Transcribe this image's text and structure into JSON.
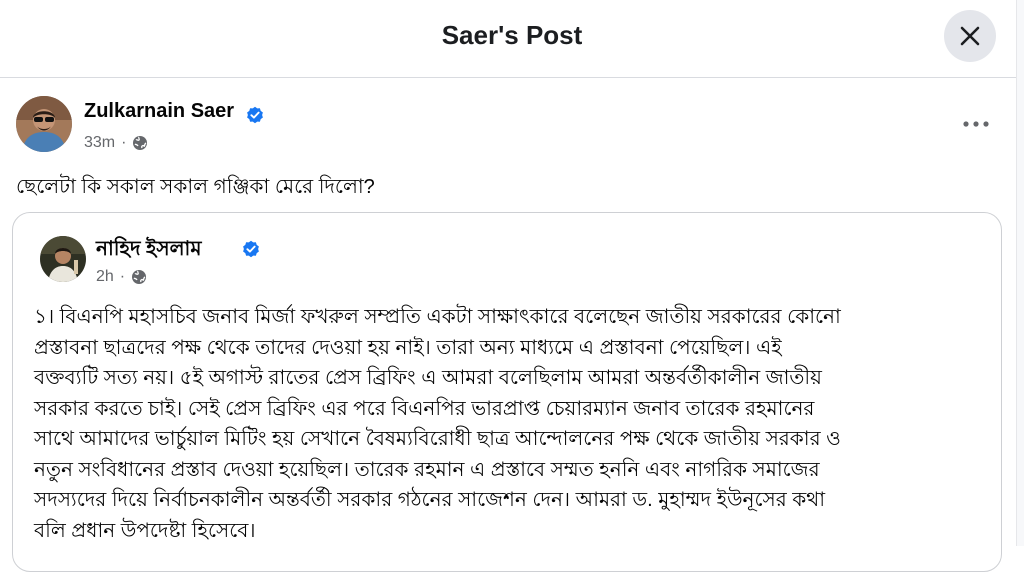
{
  "dialog": {
    "title": "Saer's Post",
    "close_icon": "close-icon"
  },
  "post": {
    "author": "Zulkarnain Saer",
    "time": "33m",
    "separator": "·",
    "privacy_icon": "globe-icon",
    "verified_icon": "verified-badge-icon",
    "more_icon": "more-options-icon",
    "text": "ছেলেটা কি সকাল সকাল গঞ্জিকা মেরে দিলো?"
  },
  "shared_post": {
    "author": "নাহিদ ইসলাম",
    "time": "2h",
    "separator": "·",
    "privacy_icon": "globe-icon",
    "verified_icon": "verified-badge-icon",
    "lines": [
      "১। বিএনপি মহাসচিব জনাব মির্জা ফখরুল সম্প্রতি একটা সাক্ষাৎকারে বলেছেন জাতীয় সরকারের কোনো",
      "প্রস্তাবনা ছাত্রদের পক্ষ থেকে তাদের দেওয়া হয় নাই। তারা অন্য মাধ্যমে এ প্রস্তাবনা পেয়েছিল। এই",
      "বক্তব্যটি সত্য নয়। ৫ই অগাস্ট রাতের প্রেস ব্রিফিং এ আমরা বলেছিলাম আমরা অন্তর্বর্তীকালীন জাতীয়",
      "সরকার করতে চাই। সেই প্রেস ব্রিফিং এর পরে বিএনপির ভারপ্রাপ্ত চেয়ারম্যান জনাব তারেক রহমানের",
      "সাথে আমাদের ভার্চুয়াল মিটিং হয় সেখানে বৈষম্যবিরোধী ছাত্র আন্দোলনের পক্ষ থেকে জাতীয় সরকার ও",
      "নতুন সংবিধানের প্রস্তাব দেওয়া হয়েছিল। তারেক রহমান এ প্রস্তাবে সম্মত হননি এবং নাগরিক সমাজের",
      "সদস্যদের দিয়ে নির্বাচনকালীন অন্তর্বর্তী সরকার গঠনের সাজেশন দেন। আমরা ড. মুহাম্মদ ইউনূসের কথা",
      "বলি প্রধান উপদেষ্টা হিসেবে।"
    ]
  },
  "colors": {
    "verified_blue": "#1877f2",
    "meta_gray": "#65676b",
    "close_bg": "#e4e6eb"
  }
}
